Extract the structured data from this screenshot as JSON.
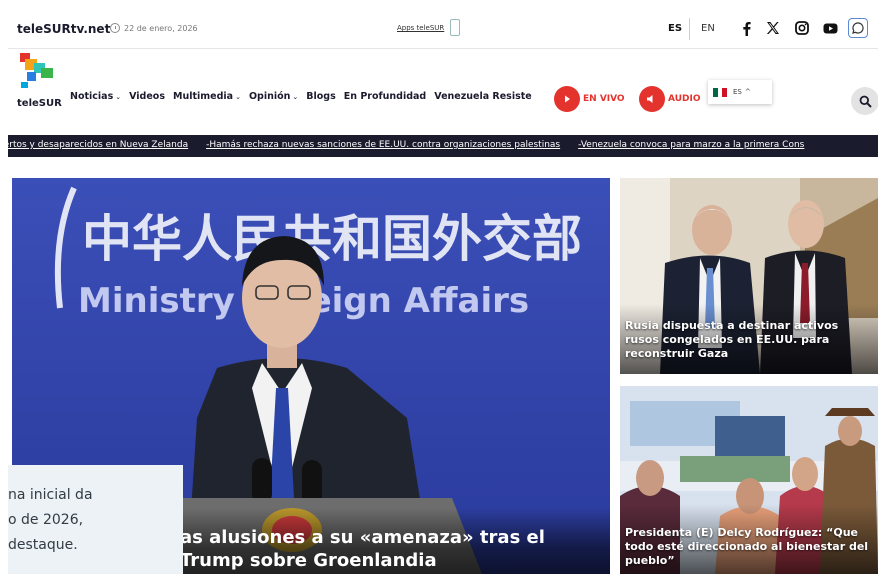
{
  "header": {
    "site_name": "teleSURtv.net",
    "date": "22 de enero, 2026",
    "apps_label": "Apps teleSUR",
    "lang_active": "ES",
    "lang_other": "EN",
    "social_icons": [
      "facebook-icon",
      "x-icon",
      "instagram-icon",
      "youtube-icon",
      "whatsapp-icon"
    ]
  },
  "nav": {
    "logo_text": "teleSUR",
    "items": [
      {
        "label": "Noticias",
        "dropdown": true
      },
      {
        "label": "Videos",
        "dropdown": false
      },
      {
        "label": "Multimedia",
        "dropdown": true
      },
      {
        "label": "Opinión",
        "dropdown": true
      },
      {
        "label": "Blogs",
        "dropdown": false
      },
      {
        "label": "En Profundidad",
        "dropdown": false
      },
      {
        "label": "Venezuela Resiste",
        "dropdown": false
      }
    ],
    "live_label": "EN VIVO",
    "audio_label": "AUDIO",
    "language_select": "ES",
    "accent_color": "#e4332d"
  },
  "ticker": {
    "items": [
      "uertos y desaparecidos en Nueva Zelanda",
      "-Hamás rechaza nuevas sanciones de EE.UU. contra organizaciones palestinas",
      "-Venezuela convoca para marzo a la primera Cons"
    ]
  },
  "hero": {
    "backdrop_text_cn": "中华人民共和国外交部",
    "backdrop_text_en": "Ministry Foreign Affairs",
    "title": "as alusiones a su «amenaza» tras el Trump sobre Groenlandia"
  },
  "cards": [
    {
      "title": "Rusia dispuesta a destinar activos rusos congelados en EE.UU. para reconstruir Gaza"
    },
    {
      "title": "Presidenta (E) Delcy Rodríguez: “Que todo esté direccionado al bienestar del pueblo”"
    }
  ],
  "overlay": {
    "text": "na inicial da\no de 2026,\ndestaque."
  }
}
